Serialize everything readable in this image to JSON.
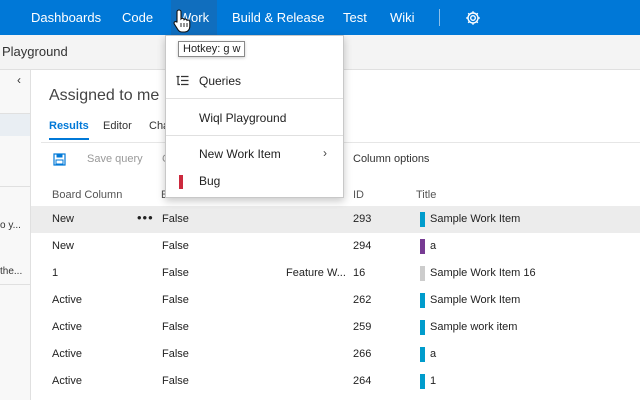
{
  "nav": {
    "items": [
      "Dashboards",
      "Code",
      "Work",
      "Build & Release",
      "Test",
      "Wiki"
    ],
    "active": "Work",
    "settings_icon": "gear-icon"
  },
  "subbar": {
    "title": "Playground"
  },
  "left_panel": {
    "collapse_icon": "chevron-left-icon",
    "fragments": [
      "o y...",
      "the..."
    ]
  },
  "main": {
    "title": "Assigned to me",
    "tabs": [
      "Results",
      "Editor",
      "Cha"
    ],
    "active_tab": "Results",
    "toolbar": {
      "save_icon": "save-query-icon",
      "save_query": "Save query",
      "hidden_initial": "C",
      "column_options": "Column options"
    },
    "columns": [
      "Board Column",
      "E",
      "ID",
      "Title"
    ],
    "rows": [
      {
        "board_column": "New",
        "col2": "False",
        "col3": "",
        "id": "293",
        "title": "Sample Work Item",
        "color": "#009ccc",
        "selected": true
      },
      {
        "board_column": "New",
        "col2": "False",
        "col3": "",
        "id": "294",
        "title": "a",
        "color": "#773b93",
        "selected": false
      },
      {
        "board_column": "1",
        "col2": "False",
        "col3": "Feature W...",
        "id": "16",
        "title": "Sample Work Item 16",
        "color": "#cccccc",
        "selected": false
      },
      {
        "board_column": "Active",
        "col2": "False",
        "col3": "",
        "id": "262",
        "title": "Sample Work Item",
        "color": "#009ccc",
        "selected": false
      },
      {
        "board_column": "Active",
        "col2": "False",
        "col3": "",
        "id": "259",
        "title": "Sample work item",
        "color": "#009ccc",
        "selected": false
      },
      {
        "board_column": "Active",
        "col2": "False",
        "col3": "",
        "id": "266",
        "title": "a",
        "color": "#009ccc",
        "selected": false
      },
      {
        "board_column": "Active",
        "col2": "False",
        "col3": "",
        "id": "264",
        "title": "1",
        "color": "#009ccc",
        "selected": false
      }
    ],
    "row_more_icon": "more-actions-icon"
  },
  "menu": {
    "tooltip": "Hotkey: g w",
    "queries": "Queries",
    "wiql": "Wiql Playground",
    "new_work_item": "New Work Item",
    "bug": "Bug",
    "bug_color": "#cc293d"
  },
  "colors": {
    "accent": "#0078d7",
    "nav_active": "#106ebe"
  }
}
